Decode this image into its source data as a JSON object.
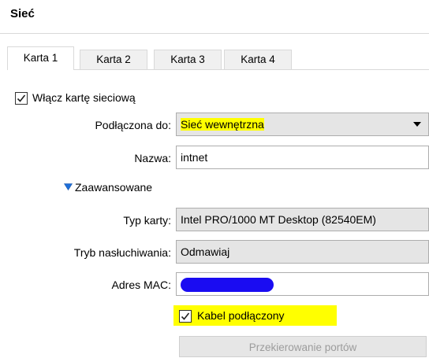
{
  "header": {
    "title": "Sieć"
  },
  "tabs": [
    {
      "label": "Karta 1",
      "active": true
    },
    {
      "label": "Karta 2",
      "active": false
    },
    {
      "label": "Karta 3",
      "active": false
    },
    {
      "label": "Karta 4",
      "active": false
    }
  ],
  "enable_adapter": {
    "label": "Włącz kartę sieciową",
    "checked": true
  },
  "attached_to": {
    "label": "Podłączona do:",
    "value": "Sieć wewnętrzna"
  },
  "name": {
    "label": "Nazwa:",
    "value": "intnet"
  },
  "advanced": {
    "label": "Zaawansowane"
  },
  "adapter_type": {
    "label": "Typ karty:",
    "value": "Intel PRO/1000 MT Desktop (82540EM)"
  },
  "promiscuous": {
    "label": "Tryb nasłuchiwania:",
    "value": "Odmawiaj"
  },
  "mac": {
    "label": "Adres MAC:"
  },
  "cable": {
    "label": "Kabel podłączony",
    "checked": true
  },
  "port_forwarding": {
    "label": "Przekierowanie portów"
  },
  "colors": {
    "highlight": "#ffff00",
    "mac_redaction": "#1a0cf2",
    "advanced_arrow": "#1e6fd9"
  },
  "icons": {
    "checkbox": "checkmark-icon",
    "dropdown": "chevron-down-icon",
    "disclosure": "triangle-down-icon"
  }
}
